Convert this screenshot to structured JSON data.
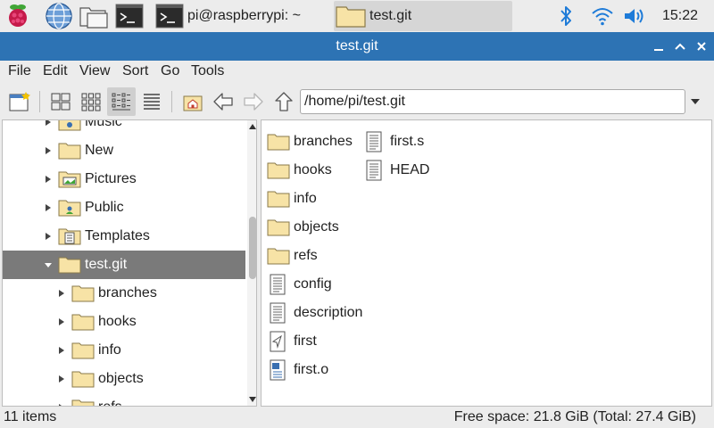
{
  "taskbar": {
    "terminal_task_label": "pi@raspberrypi: ~",
    "filemanager_task_label": "test.git",
    "clock": "15:22"
  },
  "window": {
    "title": "test.git",
    "controls": [
      "minimize",
      "maximize",
      "close"
    ]
  },
  "menu": [
    "File",
    "Edit",
    "View",
    "Sort",
    "Go",
    "Tools"
  ],
  "path": {
    "value": "/home/pi/test.git"
  },
  "sidebar": {
    "items": [
      {
        "label": "Music",
        "icon": "music-folder-icon"
      },
      {
        "label": "New",
        "icon": "folder-icon"
      },
      {
        "label": "Pictures",
        "icon": "pictures-folder-icon"
      },
      {
        "label": "Public",
        "icon": "public-folder-icon"
      },
      {
        "label": "Templates",
        "icon": "templates-folder-icon"
      },
      {
        "label": "test.git",
        "icon": "folder-icon",
        "selected": true,
        "expanded": true
      },
      {
        "label": "branches",
        "icon": "folder-icon"
      },
      {
        "label": "hooks",
        "icon": "folder-icon"
      },
      {
        "label": "info",
        "icon": "folder-icon"
      },
      {
        "label": "objects",
        "icon": "folder-icon"
      },
      {
        "label": "refs",
        "icon": "folder-icon"
      }
    ]
  },
  "files": [
    {
      "name": "branches",
      "type": "folder"
    },
    {
      "name": "hooks",
      "type": "folder"
    },
    {
      "name": "info",
      "type": "folder"
    },
    {
      "name": "objects",
      "type": "folder"
    },
    {
      "name": "refs",
      "type": "folder"
    },
    {
      "name": "config",
      "type": "text"
    },
    {
      "name": "description",
      "type": "text"
    },
    {
      "name": "first",
      "type": "executable"
    },
    {
      "name": "first.o",
      "type": "object"
    },
    {
      "name": "first.s",
      "type": "text"
    },
    {
      "name": "HEAD",
      "type": "text"
    }
  ],
  "status": {
    "count": "11 items",
    "free_space": "Free space: 21.8 GiB (Total: 27.4 GiB)"
  },
  "colors": {
    "titlebar": "#2d73b4",
    "accent": "#2d73b4",
    "selected_row": "#7a7a7a",
    "folder_fill": "#f7e3a6"
  }
}
